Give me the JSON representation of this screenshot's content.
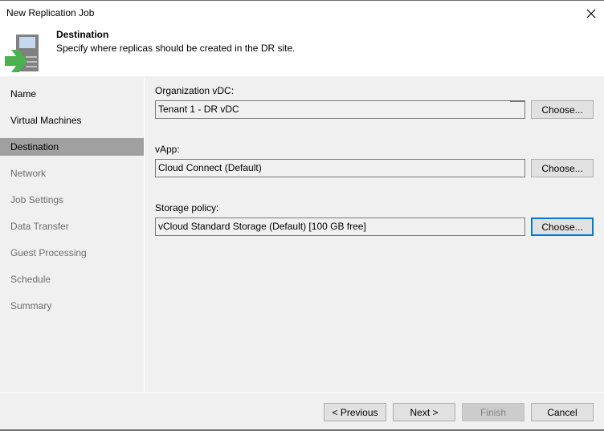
{
  "window": {
    "title": "New Replication Job",
    "close_icon": "close-icon"
  },
  "header": {
    "icon": "replication-job-icon",
    "step_title": "Destination",
    "step_description": "Specify where replicas should be created in the DR site."
  },
  "sidebar": {
    "items": [
      {
        "label": "Name",
        "state": "enabled"
      },
      {
        "label": "Virtual Machines",
        "state": "enabled"
      },
      {
        "label": "Destination",
        "state": "active"
      },
      {
        "label": "Network",
        "state": "disabled"
      },
      {
        "label": "Job Settings",
        "state": "disabled"
      },
      {
        "label": "Data Transfer",
        "state": "disabled"
      },
      {
        "label": "Guest Processing",
        "state": "disabled"
      },
      {
        "label": "Schedule",
        "state": "disabled"
      },
      {
        "label": "Summary",
        "state": "disabled"
      }
    ]
  },
  "main": {
    "fields": [
      {
        "label": "Organization vDC:",
        "value": "Tenant 1 - DR vDC",
        "button": "Choose..."
      },
      {
        "label": "vApp:",
        "value": "Cloud Connect (Default)",
        "button": "Choose..."
      },
      {
        "label": "Storage policy:",
        "value": "vCloud Standard Storage (Default) [100 GB free]",
        "button": "Choose..."
      }
    ]
  },
  "footer": {
    "previous": "< Previous",
    "next": "Next >",
    "finish": "Finish",
    "cancel": "Cancel"
  },
  "colors": {
    "accent_focus": "#0078d7",
    "arrow_green": "#4caf50",
    "active_nav_bg": "#a0a0a0"
  }
}
